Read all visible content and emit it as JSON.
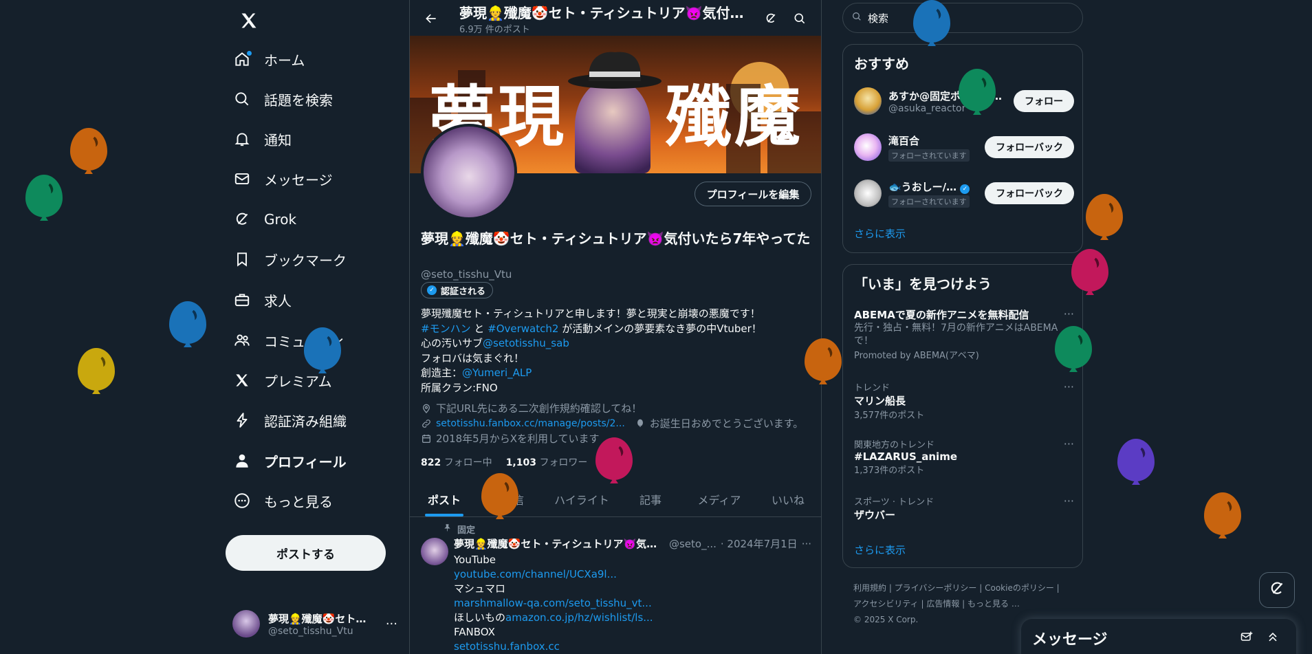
{
  "nav": {
    "items": [
      {
        "label": "ホーム",
        "icon": "home-icon"
      },
      {
        "label": "話題を検索",
        "icon": "search-icon"
      },
      {
        "label": "通知",
        "icon": "bell-icon"
      },
      {
        "label": "メッセージ",
        "icon": "mail-icon"
      },
      {
        "label": "Grok",
        "icon": "grok-icon"
      },
      {
        "label": "ブックマーク",
        "icon": "bookmark-icon"
      },
      {
        "label": "求人",
        "icon": "briefcase-icon"
      },
      {
        "label": "コミュニティ",
        "icon": "people-icon"
      },
      {
        "label": "プレミアム",
        "icon": "x-icon"
      },
      {
        "label": "認証済み組織",
        "icon": "lightning-icon"
      },
      {
        "label": "プロフィール",
        "icon": "person-icon"
      },
      {
        "label": "もっと見る",
        "icon": "more-circle-icon"
      }
    ],
    "post_button": "ポストする",
    "account": {
      "name": "夢現👷殲魔🤡セト…",
      "handle": "@seto_tisshu_Vtu"
    }
  },
  "header": {
    "title": "夢現👷殲魔🤡セト・ティシュトリア👿気付…",
    "post_count": "6.9万 件のポスト"
  },
  "banner": {
    "text_left": "夢現",
    "text_right": "殲魔"
  },
  "profile": {
    "edit_button": "プロフィールを編集",
    "display_name": "夢現👷殲魔🤡セト・ティシュトリア👿気付いたら7年やってた",
    "handle": "@seto_tisshu_Vtu",
    "verified_label": "認証される",
    "bio": {
      "line1": "夢現殲魔セト・ティシュトリアと申します！夢と現実と崩壊の悪魔です！",
      "line2_tag1": "#モンハン",
      "line2_and": " と ",
      "line2_tag2": "#Overwatch2",
      "line2_rest": " が活動メインの夢要素なき夢の中Vtuber！",
      "line3_text": "心の汚いサブ",
      "line3_link": "@setotisshu_sab",
      "line4": "フォロバは気まぐれ！",
      "line5_text": "創造主：",
      "line5_link": "@Yumeri_ALP",
      "line6": "所属クラン:FNO"
    },
    "location": "下記URL先にある二次創作規約確認してね！",
    "url": "setotisshu.fanbox.cc/manage/posts/2...",
    "birthday": "お誕生日おめでとうございます。",
    "joined": "2018年5月からXを利用しています",
    "following_count": "822",
    "following_label": "フォロー中",
    "followers_count": "1,103",
    "followers_label": "フォロワー"
  },
  "tabs": [
    "ポスト",
    "返信",
    "ハイライト",
    "記事",
    "メディア",
    "いいね"
  ],
  "pinned_post": {
    "pinned_label": "固定",
    "author": "夢現👷殲魔🤡セト・ティシュトリア👿気付…",
    "handle": "@seto_...",
    "date": "· 2024年7月1日",
    "lines": [
      {
        "text": "YouTube",
        "link": false
      },
      {
        "text": "youtube.com/channel/UCXa9l...",
        "link": true
      },
      {
        "text": "マシュマロ",
        "link": false
      },
      {
        "text": "marshmallow-qa.com/seto_tisshu_vt...",
        "link": true
      },
      {
        "text": "ほしいもの",
        "link": false,
        "suffix": "amazon.co.jp/hz/wishlist/ls..."
      },
      {
        "text": "FANBOX",
        "link": false
      },
      {
        "text": "setotisshu.fanbox.cc",
        "link": true
      }
    ]
  },
  "right": {
    "search_placeholder": "検索",
    "recommend_title": "おすすめ",
    "recommend": [
      {
        "name": "あすか@固定ポスト見…",
        "sub": "@asuka_reactor",
        "button": "フォロー",
        "followed": ""
      },
      {
        "name": "滝百合",
        "sub": "",
        "button": "フォローバック",
        "followed": "フォローされています"
      },
      {
        "name": "🐟うおしー/…",
        "sub": "",
        "button": "フォローバック",
        "followed": "フォローされています"
      }
    ],
    "show_more": "さらに表示",
    "whats_title": "「いま」を見つけよう",
    "trends": [
      {
        "context": "",
        "title": "ABEMAで夏の新作アニメを無料配信",
        "desc": "先行・独占・無料！7月の新作アニメはABEMAで！",
        "count": "Promoted by ABEMA(アベマ)"
      },
      {
        "context": "トレンド",
        "title": "マリン船長",
        "desc": "",
        "count": "3,577件のポスト"
      },
      {
        "context": "関東地方のトレンド",
        "title": "#LAZARUS_anime",
        "desc": "",
        "count": "1,373件のポスト"
      },
      {
        "context": "スポーツ · トレンド",
        "title": "ザウバー",
        "desc": "",
        "count": ""
      }
    ],
    "show_more_2": "さらに表示",
    "footer_line1": "利用規約 | プライバシーポリシー | Cookieのポリシー |",
    "footer_line2": "アクセシビリティ | 広告情報 | もっと見る …",
    "footer_line3": "© 2025 X Corp."
  },
  "messages_drawer": {
    "title": "メッセージ"
  },
  "colors": {
    "background": "#15202b",
    "accent": "#1d9bf0",
    "border": "#38444d"
  }
}
